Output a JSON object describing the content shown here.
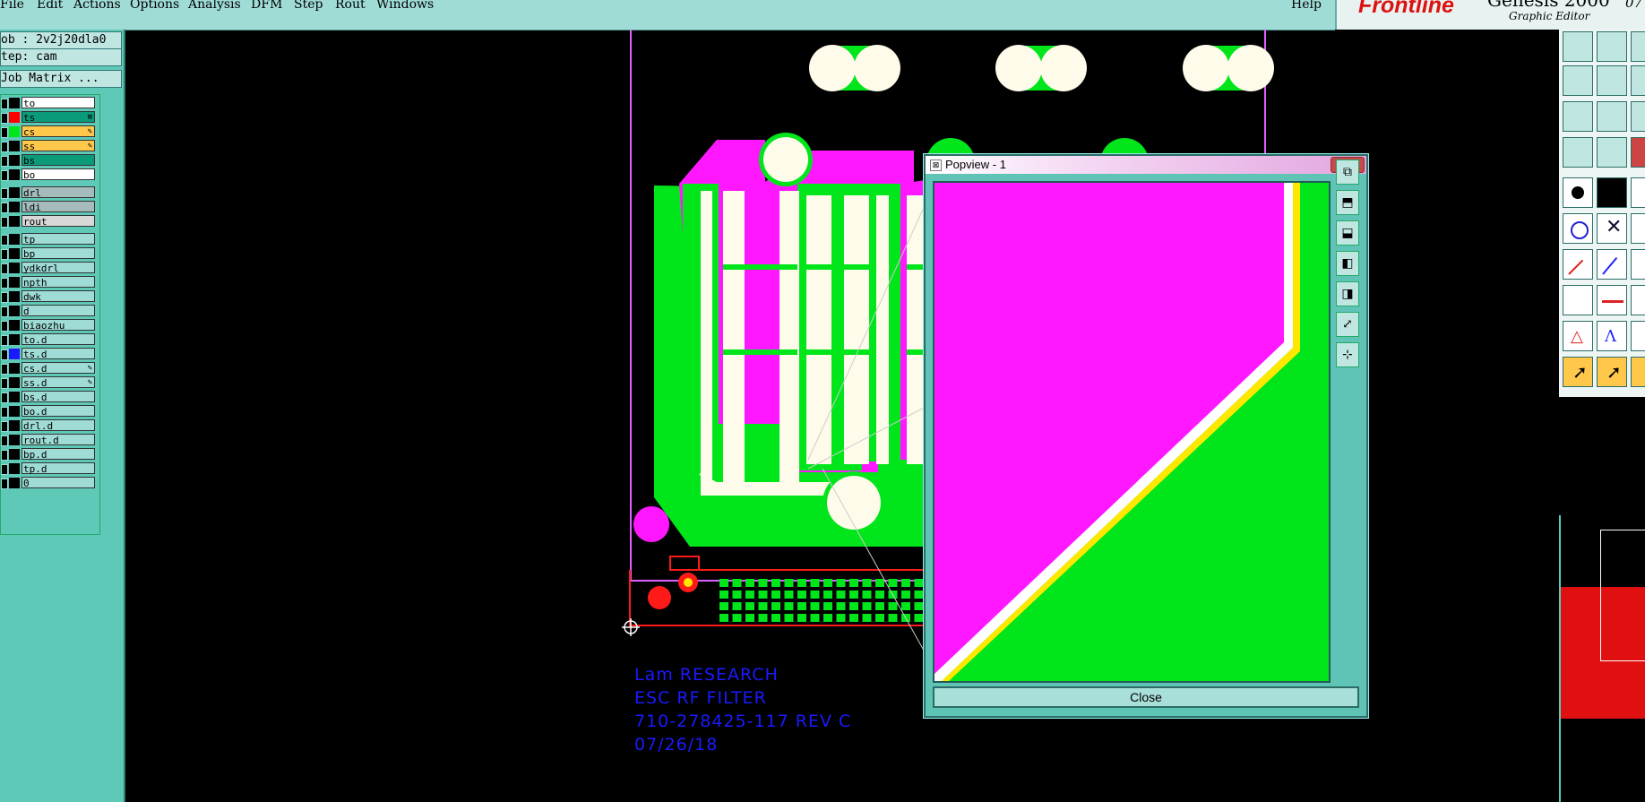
{
  "menubar": {
    "items": [
      "File",
      "Edit",
      "Actions",
      "Options",
      "Analysis",
      "DFM",
      "Step",
      "Rout",
      "Windows"
    ],
    "help": "Help"
  },
  "brand": {
    "name": "Frontline",
    "product": "Genesis 2000",
    "subtitle": "Graphic Editor",
    "date": "07"
  },
  "left_panel": {
    "job": "ob : 2v2j20dla0",
    "step": "tep: cam",
    "matrix_button": "Job Matrix ..."
  },
  "layers": [
    {
      "name": "to",
      "color": "#000000",
      "bg": "#ffffff",
      "flag": ""
    },
    {
      "name": "ts",
      "color": "#ff0000",
      "bg": "#0c9b7a",
      "flag": "⊞"
    },
    {
      "name": "cs",
      "color": "#00e61b",
      "bg": "#ffc84a",
      "flag": "✎"
    },
    {
      "name": "ss",
      "color": "#000000",
      "bg": "#ffc84a",
      "flag": "✎"
    },
    {
      "name": "bs",
      "color": "#000000",
      "bg": "#0c9b7a",
      "flag": ""
    },
    {
      "name": "bo",
      "color": "#000000",
      "bg": "#ffffff",
      "flag": ""
    },
    {
      "name": "drl",
      "color": "#000000",
      "bg": "#a6bcbc",
      "flag": ""
    },
    {
      "name": "ldi",
      "color": "#000000",
      "bg": "#a6bcbc",
      "flag": ""
    },
    {
      "name": "rout",
      "color": "#000000",
      "bg": "#d8d8d8",
      "flag": ""
    },
    {
      "name": "tp",
      "color": "#000000",
      "bg": "#9fdcd6",
      "flag": ""
    },
    {
      "name": "bp",
      "color": "#000000",
      "bg": "#9fdcd6",
      "flag": ""
    },
    {
      "name": "ydkdrl",
      "color": "#000000",
      "bg": "#9fdcd6",
      "flag": ""
    },
    {
      "name": "npth",
      "color": "#000000",
      "bg": "#9fdcd6",
      "flag": ""
    },
    {
      "name": "dwk",
      "color": "#000000",
      "bg": "#9fdcd6",
      "flag": ""
    },
    {
      "name": "d",
      "color": "#000000",
      "bg": "#9fdcd6",
      "flag": ""
    },
    {
      "name": "biaozhu",
      "color": "#000000",
      "bg": "#9fdcd6",
      "flag": ""
    },
    {
      "name": "to.d",
      "color": "#000000",
      "bg": "#9fdcd6",
      "flag": ""
    },
    {
      "name": "ts.d",
      "color": "#1a1aff",
      "bg": "#9fdcd6",
      "flag": ""
    },
    {
      "name": "cs.d",
      "color": "#000000",
      "bg": "#9fdcd6",
      "flag": "✎"
    },
    {
      "name": "ss.d",
      "color": "#000000",
      "bg": "#9fdcd6",
      "flag": "✎"
    },
    {
      "name": "bs.d",
      "color": "#000000",
      "bg": "#9fdcd6",
      "flag": ""
    },
    {
      "name": "bo.d",
      "color": "#000000",
      "bg": "#9fdcd6",
      "flag": ""
    },
    {
      "name": "drl.d",
      "color": "#000000",
      "bg": "#9fdcd6",
      "flag": ""
    },
    {
      "name": "rout.d",
      "color": "#000000",
      "bg": "#9fdcd6",
      "flag": ""
    },
    {
      "name": "bp.d",
      "color": "#000000",
      "bg": "#9fdcd6",
      "flag": ""
    },
    {
      "name": "tp.d",
      "color": "#000000",
      "bg": "#9fdcd6",
      "flag": ""
    },
    {
      "name": "0",
      "color": "#000000",
      "bg": "#9fdcd6",
      "flag": ""
    }
  ],
  "pcb_text": [
    "Lam RESEARCH",
    "ESC RF FILTER",
    "710-278425-117 REV C",
    "07/26/18"
  ],
  "popview": {
    "title": "Popview - 1",
    "close_x": "×",
    "close_button": "Close"
  },
  "colors": {
    "magenta": "#ff18ff",
    "green": "#00e61b",
    "cream": "#fffbea",
    "outline": "#e0a0ff",
    "red": "#ff1a1a",
    "blue": "#1a1aff",
    "panel": "#5fc9b8"
  }
}
